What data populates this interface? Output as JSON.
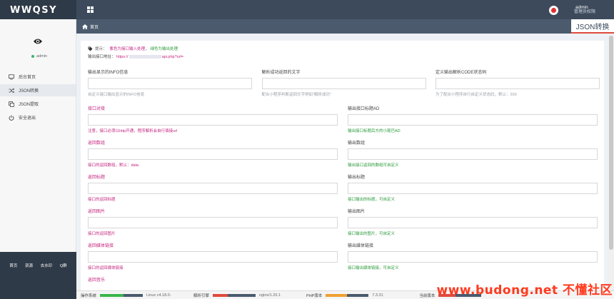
{
  "app": {
    "logo": "WWQSY"
  },
  "header": {
    "user_name": "admin",
    "user_role": "管理员权限"
  },
  "sidebar": {
    "status": "admin",
    "items": [
      {
        "label": "后台首页",
        "icon": "monitor-icon"
      },
      {
        "label": "JSON转换",
        "icon": "shuffle-icon"
      },
      {
        "label": "JSON提取",
        "icon": "copy-icon"
      },
      {
        "label": "安全退出",
        "icon": "power-icon"
      }
    ],
    "footer_links": [
      "首页",
      "资源",
      "去水印",
      "Q群"
    ]
  },
  "breadcrumb": {
    "label": "首页"
  },
  "page_title": "JSON转换",
  "notice": {
    "prefix": "提示：",
    "red": "紫色为接口输入处理",
    "sep": "，",
    "green": "绿色为输出处理"
  },
  "api_url": {
    "label": "输出接口地址：",
    "link_prefix": "https://",
    "link_suffix": "api.php?url="
  },
  "top_fields": [
    {
      "label": "输出显示的INFO信息",
      "hint": "自定义接口输出显示的INFO信息"
    },
    {
      "label": "解析成功返回的文字",
      "hint": "配合小程序判断返回文字例如\"解析成功\""
    },
    {
      "label": "定义输出解析CODE状态码",
      "hint": "为了配合小程序自行自定义状态码，默认：200"
    }
  ],
  "rows": [
    {
      "left": {
        "label": "接口对接",
        "hint": "注意，接口必须以http开通，程序解析会自行填接url"
      },
      "right": {
        "label": "输出接口标题AD",
        "hint": "输出接口标题后方的小尾巴AD"
      }
    },
    {
      "left": {
        "label": "返回数组",
        "hint": "接口的返回数组，默认：data"
      },
      "right": {
        "label": "输出数组",
        "hint": "输出接口返回的数组可自定义"
      }
    },
    {
      "left": {
        "label": "返回标题",
        "hint": "接口的返回标题"
      },
      "right": {
        "label": "输出标题",
        "hint": "接口输出的标题，可自定义"
      }
    },
    {
      "left": {
        "label": "返回图片",
        "hint": "接口的返回图片"
      },
      "right": {
        "label": "输出图片",
        "hint": "接口输出的图片，可自定义"
      }
    },
    {
      "left": {
        "label": "返回媒体链接",
        "hint": "接口的返回媒体链接"
      },
      "right": {
        "label": "输出媒体链接",
        "hint": "接口输出媒体链接，可自定义"
      }
    }
  ],
  "partial_row_label": "返回音乐",
  "status_bar": [
    {
      "label": "操作系统",
      "value": "Linux c4.18.0-"
    },
    {
      "label": "解析引擎",
      "value": "nginx/1.20.1"
    },
    {
      "label": "PHP版本",
      "value": "7.3.31"
    },
    {
      "label": "当前版本",
      "value": ""
    }
  ],
  "watermark": "www.budong.net 不懂社区",
  "colors": {
    "topbar": "#3c4a5c",
    "accent_red": "#e04a3d",
    "input_pink": "#c4267f",
    "output_green": "#2a9a3a"
  }
}
